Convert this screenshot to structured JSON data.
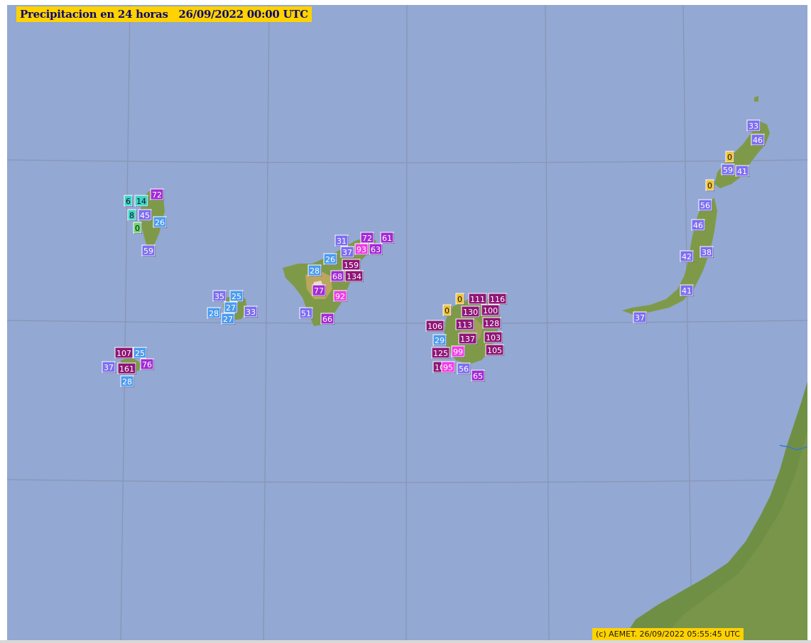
{
  "map": {
    "title": "Precipitacion en 24 horas   26/09/2022 00:00 UTC",
    "copyright": "(c) AEMET. 26/09/2022 05:55:45 UTC",
    "colors": {
      "sea": "#93a8d2",
      "grid": "#8895b6",
      "land": "#6f8f45",
      "title_bg": "#ffd200"
    },
    "legend_classes": {
      "yellow": "#f1c232",
      "cyan": "#3dd3c8",
      "green": "#6bd46b",
      "lightblue": "#4b9bf0",
      "blue": "#3f6fe0",
      "violet": "#7d6ef2",
      "purple": "#a22bd6",
      "magenta": "#f03ce6",
      "darkmagenta": "#8e1676"
    },
    "stations": [
      {
        "island": "la-palma",
        "value": "72",
        "cls": "purple"
      },
      {
        "island": "la-palma",
        "value": "6",
        "cls": "cyan"
      },
      {
        "island": "la-palma",
        "value": "14",
        "cls": "cyan"
      },
      {
        "island": "la-palma",
        "value": "8",
        "cls": "cyan"
      },
      {
        "island": "la-palma",
        "value": "45",
        "cls": "violet"
      },
      {
        "island": "la-palma",
        "value": "26",
        "cls": "lightblue"
      },
      {
        "island": "la-palma",
        "value": "0",
        "cls": "green"
      },
      {
        "island": "la-palma",
        "value": "59",
        "cls": "violet"
      },
      {
        "island": "la-gomera",
        "value": "35",
        "cls": "violet"
      },
      {
        "island": "la-gomera",
        "value": "25",
        "cls": "lightblue"
      },
      {
        "island": "la-gomera",
        "value": "27",
        "cls": "lightblue"
      },
      {
        "island": "la-gomera",
        "value": "28",
        "cls": "lightblue"
      },
      {
        "island": "la-gomera",
        "value": "33",
        "cls": "violet"
      },
      {
        "island": "la-gomera",
        "value": "27",
        "cls": "lightblue"
      },
      {
        "island": "el-hierro",
        "value": "107",
        "cls": "darkmagenta"
      },
      {
        "island": "el-hierro",
        "value": "25",
        "cls": "lightblue"
      },
      {
        "island": "el-hierro",
        "value": "37",
        "cls": "violet"
      },
      {
        "island": "el-hierro",
        "value": "161",
        "cls": "darkmagenta"
      },
      {
        "island": "el-hierro",
        "value": "76",
        "cls": "purple"
      },
      {
        "island": "el-hierro",
        "value": "28",
        "cls": "lightblue"
      },
      {
        "island": "tenerife",
        "value": "31",
        "cls": "violet"
      },
      {
        "island": "tenerife",
        "value": "72",
        "cls": "purple"
      },
      {
        "island": "tenerife",
        "value": "61",
        "cls": "purple"
      },
      {
        "island": "tenerife",
        "value": "37",
        "cls": "violet"
      },
      {
        "island": "tenerife",
        "value": "93",
        "cls": "magenta"
      },
      {
        "island": "tenerife",
        "value": "63",
        "cls": "purple"
      },
      {
        "island": "tenerife",
        "value": "26",
        "cls": "lightblue"
      },
      {
        "island": "tenerife",
        "value": "159",
        "cls": "darkmagenta"
      },
      {
        "island": "tenerife",
        "value": "28",
        "cls": "lightblue"
      },
      {
        "island": "tenerife",
        "value": "68",
        "cls": "purple"
      },
      {
        "island": "tenerife",
        "value": "134",
        "cls": "darkmagenta"
      },
      {
        "island": "tenerife",
        "value": "77",
        "cls": "purple"
      },
      {
        "island": "tenerife",
        "value": "92",
        "cls": "magenta"
      },
      {
        "island": "tenerife",
        "value": "51",
        "cls": "violet"
      },
      {
        "island": "tenerife",
        "value": "66",
        "cls": "purple"
      },
      {
        "island": "gran-canaria",
        "value": "0",
        "cls": "yellow"
      },
      {
        "island": "gran-canaria",
        "value": "111",
        "cls": "darkmagenta"
      },
      {
        "island": "gran-canaria",
        "value": "116",
        "cls": "darkmagenta"
      },
      {
        "island": "gran-canaria",
        "value": "0",
        "cls": "yellow"
      },
      {
        "island": "gran-canaria",
        "value": "130",
        "cls": "darkmagenta"
      },
      {
        "island": "gran-canaria",
        "value": "100",
        "cls": "darkmagenta"
      },
      {
        "island": "gran-canaria",
        "value": "106",
        "cls": "darkmagenta"
      },
      {
        "island": "gran-canaria",
        "value": "113",
        "cls": "darkmagenta"
      },
      {
        "island": "gran-canaria",
        "value": "128",
        "cls": "darkmagenta"
      },
      {
        "island": "gran-canaria",
        "value": "29",
        "cls": "lightblue"
      },
      {
        "island": "gran-canaria",
        "value": "137",
        "cls": "darkmagenta"
      },
      {
        "island": "gran-canaria",
        "value": "103",
        "cls": "darkmagenta"
      },
      {
        "island": "gran-canaria",
        "value": "125",
        "cls": "darkmagenta"
      },
      {
        "island": "gran-canaria",
        "value": "99",
        "cls": "magenta"
      },
      {
        "island": "gran-canaria",
        "value": "105",
        "cls": "darkmagenta"
      },
      {
        "island": "gran-canaria",
        "value": "107",
        "cls": "darkmagenta"
      },
      {
        "island": "gran-canaria",
        "value": "95",
        "cls": "magenta"
      },
      {
        "island": "gran-canaria",
        "value": "56",
        "cls": "violet"
      },
      {
        "island": "gran-canaria",
        "value": "65",
        "cls": "purple"
      },
      {
        "island": "lanzarote",
        "value": "33",
        "cls": "violet"
      },
      {
        "island": "lanzarote",
        "value": "46",
        "cls": "violet"
      },
      {
        "island": "lanzarote",
        "value": "0",
        "cls": "yellow"
      },
      {
        "island": "lanzarote",
        "value": "59",
        "cls": "violet"
      },
      {
        "island": "lanzarote",
        "value": "41",
        "cls": "violet"
      },
      {
        "island": "lanzarote",
        "value": "0",
        "cls": "yellow"
      },
      {
        "island": "fuerteventura",
        "value": "56",
        "cls": "violet"
      },
      {
        "island": "fuerteventura",
        "value": "46",
        "cls": "violet"
      },
      {
        "island": "fuerteventura",
        "value": "42",
        "cls": "violet"
      },
      {
        "island": "fuerteventura",
        "value": "38",
        "cls": "violet"
      },
      {
        "island": "fuerteventura",
        "value": "41",
        "cls": "violet"
      },
      {
        "island": "fuerteventura",
        "value": "37",
        "cls": "violet"
      }
    ]
  }
}
